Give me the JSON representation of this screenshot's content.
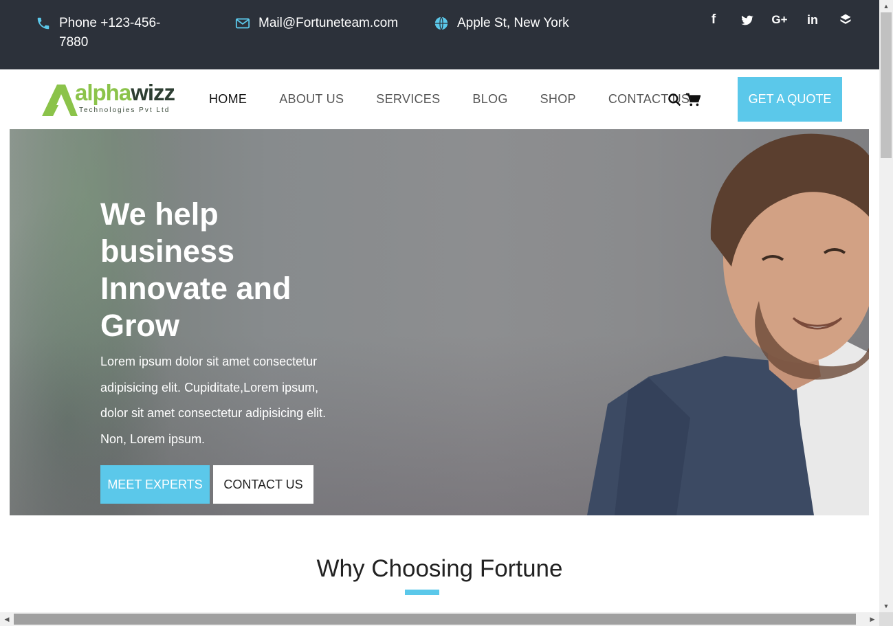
{
  "topbar": {
    "phone": "Phone +123-456-7880",
    "mail": "Mail@Fortuneteam.com",
    "address": "Apple St, New York",
    "social": [
      "facebook-icon",
      "twitter-icon",
      "google-plus-icon",
      "linkedin-icon",
      "layers-icon"
    ]
  },
  "brand": {
    "name_part1": "alpha",
    "name_part2": "wizz",
    "tagline": "Technologies Pvt Ltd"
  },
  "nav": {
    "items": [
      {
        "label": "HOME",
        "active": true
      },
      {
        "label": "ABOUT US",
        "active": false
      },
      {
        "label": "SERVICES",
        "active": false
      },
      {
        "label": "BLOG",
        "active": false
      },
      {
        "label": "SHOP",
        "active": false
      },
      {
        "label": "CONTACT US",
        "active": false
      }
    ],
    "quote_button": "GET A QUOTE"
  },
  "hero": {
    "title": "We help business Innovate and Grow",
    "text": "Lorem ipsum dolor sit amet consectetur adipisicing elit. Cupiditate,Lorem ipsum, dolor sit amet consectetur adipisicing elit. Non, Lorem ipsum.",
    "primary_button": "MEET EXPERTS",
    "secondary_button": "CONTACT US"
  },
  "section": {
    "title": "Why Choosing Fortune"
  },
  "colors": {
    "accent": "#5bc8ea",
    "topbar_bg": "#2c313a",
    "brand_green": "#8bc34a"
  }
}
